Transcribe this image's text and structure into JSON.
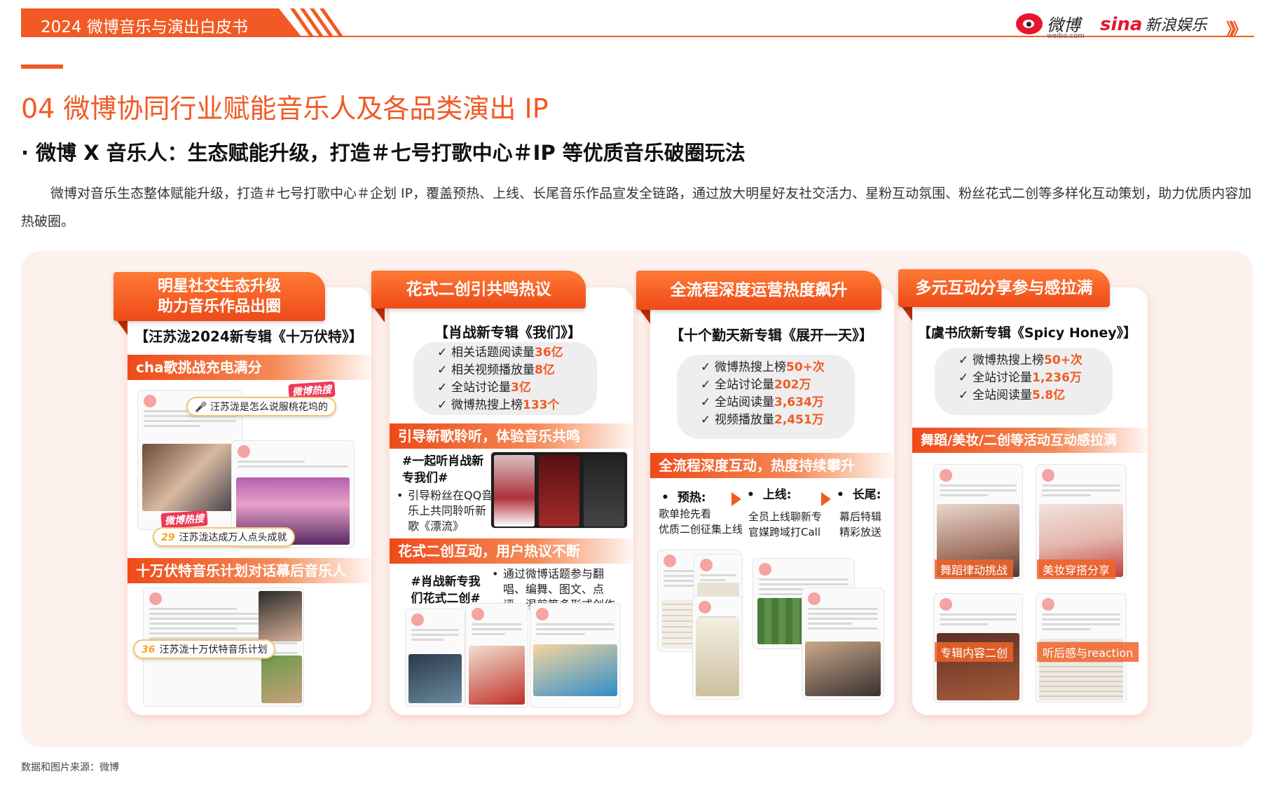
{
  "header": {
    "title": "2024 微博音乐与演出白皮书",
    "weibo_logo_text": "微博",
    "weibo_logo_sub": "weibo.com",
    "sina_logo_mark": "sina",
    "sina_logo_text": "新浪娱乐",
    "chevrons": "》》"
  },
  "section": {
    "title": "04  微博协同行业赋能音乐人及各品类演出 IP",
    "subtitle": "·  微博 X 音乐人：生态赋能升级，打造＃七号打歌中心＃IP 等优质音乐破圈玩法",
    "intro": "微博对音乐生态整体赋能升级，打造＃七号打歌中心＃企划 IP，覆盖预热、上线、长尾音乐作品宣发全链路，通过放大明星好友社交活力、星粉互动氛围、粉丝花式二创等多样化互动策划，助力优质内容加热破圈。"
  },
  "cards": [
    {
      "tab_line1": "明星社交生态升级",
      "tab_line2": "助力音乐作品出圈",
      "album": "【汪苏泷2024新专辑《十万伏特》】",
      "band1": "cha歌挑战充电满分",
      "hot_label": "微博热搜",
      "pill1_text": "汪苏泷是怎么说服桃花坞的",
      "pill2_num": "29",
      "pill2_text": "汪苏泷达成万人点头成就",
      "band2": "十万伏特音乐计划对话幕后音乐人",
      "pill3_num": "36",
      "pill3_text": "汪苏泷十万伏特音乐计划"
    },
    {
      "tab": "花式二创引共鸣热议",
      "album": "【肖战新专辑《我们》】",
      "stats": [
        {
          "label": "相关话题阅读量",
          "value": "36亿"
        },
        {
          "label": "相关视频播放量",
          "value": "8亿"
        },
        {
          "label": "全站讨论量",
          "value": "3亿"
        },
        {
          "label": "微博热搜上榜",
          "value": "133个"
        }
      ],
      "band1": "引导新歌聆听，体验音乐共鸣",
      "topic1": "#一起听肖战新专我们#",
      "bullet1": "引导粉丝在QQ音乐上共同聆听新歌《漂流》",
      "band2": "花式二创互动，用户热议不断",
      "topic2": "#肖战新专我们花式二创#",
      "bullet2": "通过微博话题参与翻唱、编舞、图文、点评、混剪等多形式创作"
    },
    {
      "tab": "全流程深度运营热度飙升",
      "album": "【十个勤天新专辑《展开一天》】",
      "stats": [
        {
          "label": "微博热搜上榜",
          "value": "50+次"
        },
        {
          "label": "全站讨论量",
          "value": "202万"
        },
        {
          "label": "全站阅读量",
          "value": "3,634万"
        },
        {
          "label": "视频播放量",
          "value": "2,451万"
        }
      ],
      "band1": "全流程深度互动，热度持续攀升",
      "phases": [
        {
          "title": "预热:",
          "desc": "歌单抢先看\n优质二创征集上线"
        },
        {
          "title": "上线:",
          "desc": "全员上线聊新专\n官媒跨域打Call"
        },
        {
          "title": "长尾:",
          "desc": "幕后特辑\n精彩放送"
        }
      ]
    },
    {
      "tab": "多元互动分享参与感拉满",
      "album": "【虞书欣新专辑《Spicy Honey》】",
      "stats": [
        {
          "label": "微博热搜上榜",
          "value": "50+次"
        },
        {
          "label": "全站讨论量",
          "value": "1,236万"
        },
        {
          "label": "全站阅读量",
          "value": "5.8亿"
        }
      ],
      "band1": "舞蹈/美妆/二创等活动互动感拉满",
      "labels": [
        "舞蹈律动挑战",
        "美妆穿搭分享",
        "专辑内容二创",
        "听后感与reaction"
      ]
    }
  ],
  "source": "数据和图片来源：微博",
  "colors": {
    "accent": "#f15a24",
    "panel_bg": "#fdf1ed",
    "hot_pink": "#ee3a5a"
  }
}
